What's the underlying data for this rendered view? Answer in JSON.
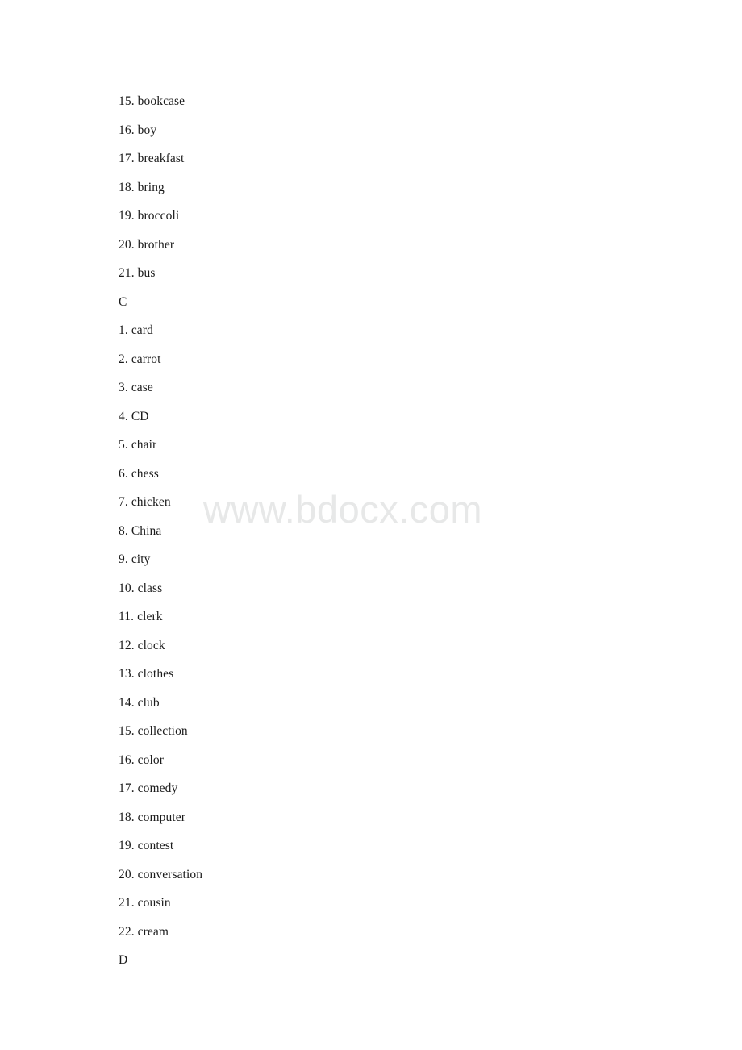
{
  "document": {
    "type": "vocabulary-word-list",
    "page_background": "#ffffff",
    "text_color": "#1b1b1b"
  },
  "watermark": {
    "text": "www.bdocx.com",
    "color": "#e7e8e8"
  },
  "lines": [
    {
      "kind": "item",
      "num": "15.",
      "word": "bookcase"
    },
    {
      "kind": "item",
      "num": "16.",
      "word": "boy"
    },
    {
      "kind": "item",
      "num": "17.",
      "word": "breakfast"
    },
    {
      "kind": "item",
      "num": "18.",
      "word": "bring"
    },
    {
      "kind": "item",
      "num": "19.",
      "word": "broccoli"
    },
    {
      "kind": "item",
      "num": "20.",
      "word": "brother"
    },
    {
      "kind": "item",
      "num": "21.",
      "word": "bus"
    },
    {
      "kind": "section",
      "num": "",
      "word": "C"
    },
    {
      "kind": "item",
      "num": "1.",
      "word": "card"
    },
    {
      "kind": "item",
      "num": "2.",
      "word": "carrot"
    },
    {
      "kind": "item",
      "num": "3.",
      "word": "case"
    },
    {
      "kind": "item",
      "num": "4.",
      "word": "CD"
    },
    {
      "kind": "item",
      "num": "5.",
      "word": "chair"
    },
    {
      "kind": "item",
      "num": "6.",
      "word": "chess"
    },
    {
      "kind": "item",
      "num": "7.",
      "word": "chicken"
    },
    {
      "kind": "item",
      "num": "8.",
      "word": "China"
    },
    {
      "kind": "item",
      "num": "9.",
      "word": "city"
    },
    {
      "kind": "item",
      "num": "10.",
      "word": "class"
    },
    {
      "kind": "item",
      "num": "11.",
      "word": "clerk"
    },
    {
      "kind": "item",
      "num": "12.",
      "word": "clock"
    },
    {
      "kind": "item",
      "num": "13.",
      "word": "clothes"
    },
    {
      "kind": "item",
      "num": "14.",
      "word": "club"
    },
    {
      "kind": "item",
      "num": "15.",
      "word": "collection"
    },
    {
      "kind": "item",
      "num": "16.",
      "word": "color"
    },
    {
      "kind": "item",
      "num": "17.",
      "word": "comedy"
    },
    {
      "kind": "item",
      "num": "18.",
      "word": "computer"
    },
    {
      "kind": "item",
      "num": "19.",
      "word": "contest"
    },
    {
      "kind": "item",
      "num": "20.",
      "word": "conversation"
    },
    {
      "kind": "item",
      "num": "21.",
      "word": "cousin"
    },
    {
      "kind": "item",
      "num": "22.",
      "word": "cream"
    },
    {
      "kind": "section",
      "num": "",
      "word": "D"
    }
  ]
}
